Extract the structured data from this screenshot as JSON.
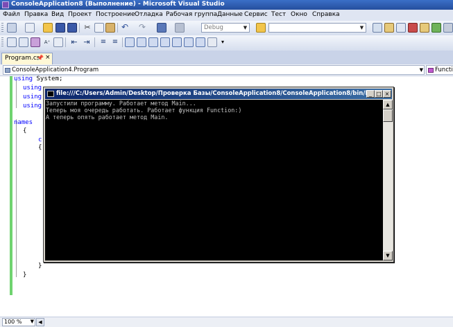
{
  "window": {
    "title": "ConsoleApplication8 (Выполнение) - Microsoft Visual Studio"
  },
  "menu": [
    "Файл",
    "Правка",
    "Вид",
    "Проект",
    "Построение",
    "Отладка",
    "Рабочая группа",
    "Данные",
    "Сервис",
    "Тест",
    "Окно",
    "Справка"
  ],
  "toolbar": {
    "config_value": "Debug",
    "find_value": ""
  },
  "tabs": {
    "active": "Program.cs"
  },
  "navigation": {
    "type_selector": "ConsoleApplication4.Program",
    "member_selector": "Function"
  },
  "code": {
    "line1_kw": "using",
    "line1_rest": " System;",
    "line2_kw": "using",
    "line3_kw": "using",
    "line4_kw": "using",
    "namespace_kw": "names",
    "brace_open": "{",
    "brace_close": "}",
    "c_fragment": "c"
  },
  "console": {
    "title": "file:///C:/Users/Admin/Desktop/Проверка Базы/ConsoleApplication8/ConsoleApplication8/bin/Debu...",
    "lines": [
      "Запустили программу. Работает метод Main...",
      "Теперь моя очередь работать. Работает функция Function:)",
      "А теперь опять работает метод Main."
    ]
  },
  "status": {
    "zoom": "100 %"
  },
  "colors": {
    "accent": "#3b6fc7",
    "keyword": "#0000ff",
    "change_bar": "#6fd36f",
    "console_bg": "#000000"
  }
}
